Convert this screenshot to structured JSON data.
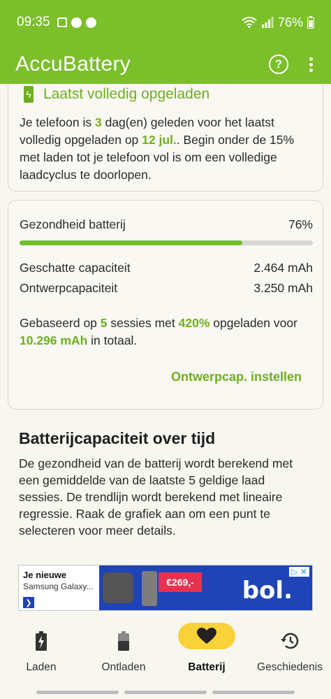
{
  "status_bar": {
    "time": "09:35",
    "battery": "76%"
  },
  "app_bar": {
    "title": "AccuBattery"
  },
  "card_last_charge": {
    "heading": "Laatst volledig opgeladen",
    "text_a": "Je telefoon is ",
    "days": "3",
    "text_b": " dag(en) geleden voor het laatst volledig opgeladen op ",
    "date": "12 jul.",
    "text_c": ". Begin onder de 15% met laden tot je telefoon vol is om een volledige laadcyclus te doorlopen."
  },
  "card_health": {
    "health_label": "Gezondheid batterij",
    "health_value": "76%",
    "health_fraction": 0.76,
    "est_label": "Geschatte capaciteit",
    "est_value": "2.464 mAh",
    "design_label": "Ontwerpcapaciteit",
    "design_value": "3.250 mAh",
    "s_a": "Gebaseerd op ",
    "sessions": "5",
    "s_b": " sessies met ",
    "percent": "420%",
    "s_c": " opgeladen voor ",
    "total": "10.296 mAh",
    "s_d": " in totaal.",
    "set_button": "Ontwerpcap. instellen"
  },
  "section": {
    "title": "Batterijcapaciteit over tijd",
    "description": "De gezondheid van de batterij wordt berekend met een gemiddelde van de laatste 5 geldige laad sessies. De trendlijn wordt berekend met lineaire regressie. Raak de grafiek aan om een punt te selecteren voor meer details."
  },
  "ad": {
    "headline": "Je nieuwe",
    "sub": "Samsung Galaxy...",
    "price": "€269,-",
    "brand": "bol."
  },
  "nav": [
    {
      "label": "Laden",
      "icon": "battery-charging-icon"
    },
    {
      "label": "Ontladen",
      "icon": "battery-discharging-icon"
    },
    {
      "label": "Batterij",
      "icon": "heart-icon"
    },
    {
      "label": "Geschiedenis",
      "icon": "history-icon"
    }
  ],
  "colors": {
    "accent": "#7bbf2a",
    "highlight": "#6fae1f",
    "nav_active": "#f9d23a"
  }
}
